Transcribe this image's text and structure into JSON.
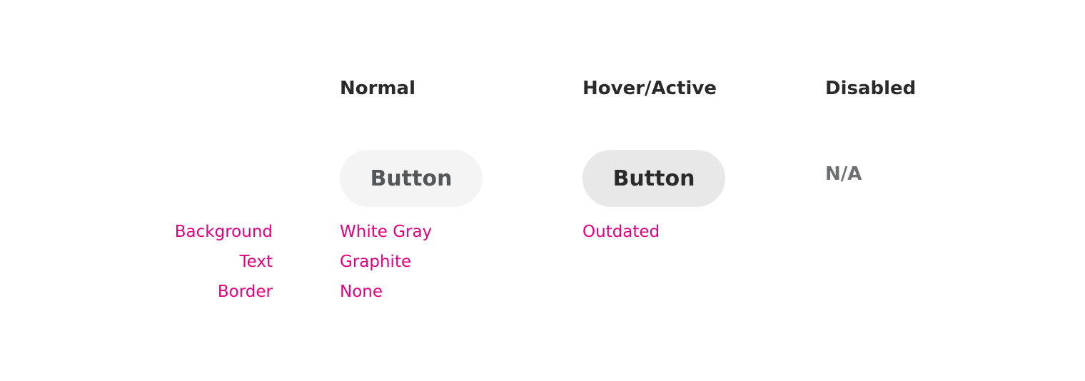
{
  "columns": {
    "normal": "Normal",
    "hover": "Hover/Active",
    "disabled": "Disabled"
  },
  "buttons": {
    "normal_label": "Button",
    "hover_label": "Button",
    "disabled_text": "N/A"
  },
  "spec_labels": {
    "background": "Background",
    "text": "Text",
    "border": "Border"
  },
  "normal_spec": {
    "background": "White Gray",
    "text": "Graphite",
    "border": "None"
  },
  "hover_spec": {
    "background": "Outdated"
  },
  "colors": {
    "accent": "#e6007e",
    "heading": "#2a2a2a",
    "normal_bg": "#f4f4f4",
    "normal_text": "#545658",
    "hover_bg": "#e8e8e8",
    "hover_text": "#2a2a2a",
    "disabled_text": "#6d6f71"
  }
}
